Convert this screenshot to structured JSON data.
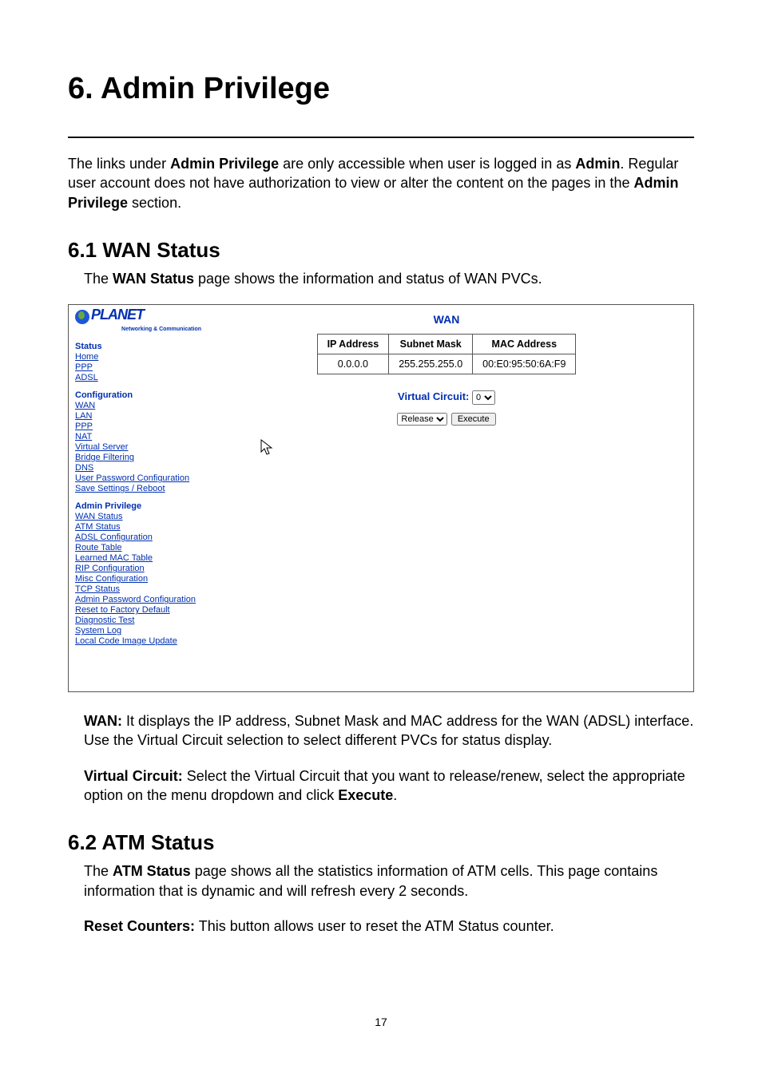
{
  "pageNumber": "17",
  "chapter": {
    "title": "6. Admin Privilege",
    "intro_prefix": "The links under ",
    "intro_bold1": "Admin Privilege",
    "intro_mid": " are only accessible when user is logged in as ",
    "intro_bold2": "Admin",
    "intro_mid2": ". Regular user account does not have authorization to view or alter the content on the pages in the ",
    "intro_bold3": "Admin Privilege",
    "intro_suffix": " section."
  },
  "section61": {
    "heading": "6.1 WAN Status",
    "lead_prefix": "The ",
    "lead_bold": "WAN Status",
    "lead_suffix": " page shows the information and status of WAN PVCs.",
    "wan_p_label": "WAN:",
    "wan_p_text": " It displays the IP address, Subnet Mask and MAC address for the WAN (ADSL) interface. Use the Virtual Circuit selection to select different PVCs for status display.",
    "vc_p_label": "Virtual Circuit:",
    "vc_p_mid": " Select the Virtual Circuit that you want to release/renew, select the appropriate option on the menu dropdown and click ",
    "vc_p_bold": "Execute",
    "vc_p_suffix": "."
  },
  "section62": {
    "heading": "6.2 ATM Status",
    "p1_prefix": "The ",
    "p1_bold": "ATM Status",
    "p1_suffix": " page shows all the statistics information of ATM cells. This page contains information that is dynamic and will refresh every 2 seconds.",
    "p2_label": "Reset Counters:",
    "p2_text": " This button allows user to reset the ATM Status counter."
  },
  "screenshot": {
    "brand": "PLANET",
    "tagline": "Networking & Communication",
    "groups": {
      "status": {
        "title": "Status",
        "links": [
          "Home",
          "PPP",
          "ADSL"
        ]
      },
      "configuration": {
        "title": "Configuration",
        "links": [
          "WAN",
          "LAN",
          "PPP",
          "NAT",
          "Virtual Server",
          "Bridge Filtering",
          "DNS",
          "User Password Configuration",
          "Save Settings / Reboot"
        ]
      },
      "admin": {
        "title": "Admin Privilege",
        "links": [
          "WAN Status",
          "ATM Status",
          "ADSL Configuration",
          "Route Table",
          "Learned MAC Table",
          "RIP Configuration",
          "Misc Configuration",
          "TCP Status",
          "Admin Password Configuration",
          "Reset to Factory Default",
          "Diagnostic Test",
          "System Log",
          "Local Code Image Update"
        ]
      }
    },
    "panel": {
      "title": "WAN",
      "headers": [
        "IP Address",
        "Subnet Mask",
        "MAC Address"
      ],
      "row": [
        "0.0.0.0",
        "255.255.255.0",
        "00:E0:95:50:6A:F9"
      ],
      "vc_label": "Virtual Circuit:",
      "vc_value": "0",
      "action_value": "Release",
      "execute_label": "Execute"
    }
  }
}
